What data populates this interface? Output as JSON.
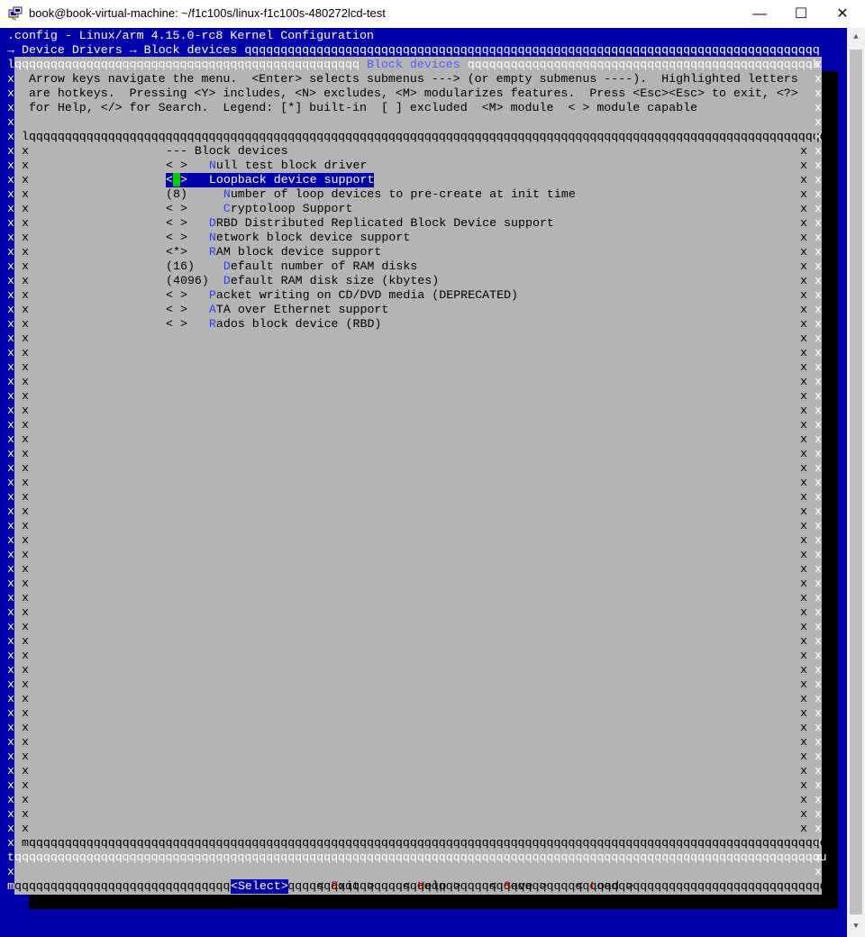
{
  "window": {
    "title": "book@book-virtual-machine: ~/f1c100s/linux-f1c100s-480272lcd-test",
    "minimize": "—",
    "maximize": "☐",
    "close": "✕"
  },
  "header": {
    "config_line": ".config - Linux/arm 4.15.0-rc8 Kernel Configuration",
    "breadcrumb": "→ Device Drivers → Block devices"
  },
  "dialog": {
    "title": "Block devices",
    "help_lines": [
      "Arrow keys navigate the menu.  <Enter> selects submenus ---> (or empty submenus ----).  Highlighted letters",
      "are hotkeys.  Pressing <Y> includes, <N> excludes, <M> modularizes features.  Press <Esc><Esc> to exit, <?>",
      "for Help, </> for Search.  Legend: [*] built-in  [ ] excluded  <M> module  < > module capable"
    ]
  },
  "menu": {
    "items": [
      {
        "prefix": "--- ",
        "hot": "",
        "rest": "Block devices",
        "indent": ""
      },
      {
        "prefix": "< >   ",
        "hot": "N",
        "rest": "ull test block driver",
        "indent": ""
      },
      {
        "prefix": "< >   ",
        "hot": "",
        "rest": "Loopback device support",
        "indent": "",
        "selected": true
      },
      {
        "prefix": "(8)     ",
        "hot": "N",
        "rest": "umber of loop devices to pre-create at init time",
        "indent": ""
      },
      {
        "prefix": "< >     ",
        "hot": "C",
        "rest": "ryptoloop Support",
        "indent": ""
      },
      {
        "prefix": "< >   ",
        "hot": "D",
        "rest": "RBD Distributed Replicated Block Device support",
        "indent": ""
      },
      {
        "prefix": "< >   ",
        "hot": "N",
        "rest": "etwork block device support",
        "indent": ""
      },
      {
        "prefix": "<*>   ",
        "hot": "R",
        "rest": "AM block device support",
        "indent": ""
      },
      {
        "prefix": "(16)    ",
        "hot": "D",
        "rest": "efault number of RAM disks",
        "indent": ""
      },
      {
        "prefix": "(4096)  ",
        "hot": "D",
        "rest": "efault RAM disk size (kbytes)",
        "indent": ""
      },
      {
        "prefix": "< >   ",
        "hot": "P",
        "rest": "acket writing on CD/DVD media (DEPRECATED)",
        "indent": ""
      },
      {
        "prefix": "< >   ",
        "hot": "A",
        "rest": "TA over Ethernet support",
        "indent": ""
      },
      {
        "prefix": "< >   ",
        "hot": "R",
        "rest": "ados block device (RBD)",
        "indent": ""
      }
    ]
  },
  "buttons": {
    "select": "<Select>",
    "exit": {
      "pre": "< ",
      "hot": "E",
      "post": "xit >"
    },
    "help": {
      "pre": "< ",
      "hot": "H",
      "post": "elp >"
    },
    "save": {
      "pre": "< ",
      "hot": "S",
      "post": "ave >"
    },
    "load": {
      "pre": "< ",
      "hot": "L",
      "post": "oad >"
    }
  },
  "colors": {
    "terminal_bg": "#0000aa",
    "dialog_bg": "#b4b4b4",
    "cursor": "#00cc00",
    "hotkey": "#3a3aff",
    "button_hotkey": "#aa0000"
  }
}
